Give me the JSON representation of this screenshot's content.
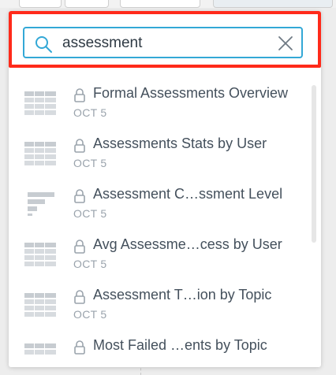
{
  "search": {
    "value": "assessment",
    "placeholder": ""
  },
  "results": [
    {
      "title": "Formal Assessments Overview",
      "date": "OCT 5",
      "icon": "table-icon",
      "locked": true
    },
    {
      "title": "Assessments Stats by User",
      "date": "OCT 5",
      "icon": "table-icon",
      "locked": true
    },
    {
      "title": "Assessment C…ssment Level",
      "date": "OCT 5",
      "icon": "bar-chart-icon",
      "locked": true
    },
    {
      "title": "Avg Assessme…cess by User",
      "date": "OCT 5",
      "icon": "table-icon",
      "locked": true
    },
    {
      "title": "Assessment T…ion by Topic",
      "date": "OCT 5",
      "icon": "table-icon",
      "locked": true
    },
    {
      "title": "Most Failed …ents by Topic",
      "date": "",
      "icon": "table-icon",
      "locked": true
    }
  ],
  "colors": {
    "highlight_border": "#ff2a1a",
    "search_border": "#33a8d6",
    "icon_gray": "#c7ccd1",
    "title_text": "#44505c",
    "date_text": "#9aa3ac"
  }
}
